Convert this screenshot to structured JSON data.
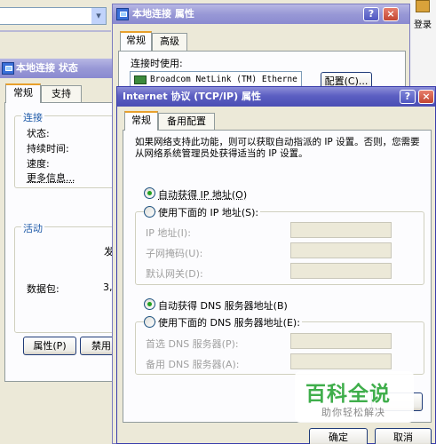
{
  "desktop": {
    "right_label": "登录"
  },
  "back_window": {
    "dropdown_arrow": "▾"
  },
  "status_window": {
    "title": "本地连接 状态",
    "tabs": [
      "常规",
      "支持"
    ],
    "connection_group": "连接",
    "rows": [
      "状态:",
      "持续时间:",
      "速度:"
    ],
    "more_info": "更多信息...",
    "activity_group": "活动",
    "sent_partial": "发",
    "packets_label": "数据包:",
    "packets_partial": "3,",
    "properties_button": "属性(P)",
    "disable_button": "禁用"
  },
  "props_window": {
    "title": "本地连接 属性",
    "tabs": [
      "常规",
      "高级"
    ],
    "connect_using_label": "连接时使用:",
    "adapter_name": "Broadcom NetLink (TM) Etherne",
    "configure_button": "配置(C)...",
    "help_button": "?",
    "close_button": "×"
  },
  "tcpip_window": {
    "title": "Internet 协议 (TCP/IP) 属性",
    "help_button": "?",
    "close_button": "×",
    "tabs": [
      "常规",
      "备用配置"
    ],
    "description": "如果网络支持此功能，则可以获取自动指派的 IP 设置。否则，您需要从网络系统管理员处获得适当的 IP 设置。",
    "auto_ip_label": "自动获得 IP 地址(O)",
    "manual_ip_label": "使用下面的 IP 地址(S):",
    "ip_address_label": "IP 地址(I):",
    "subnet_mask_label": "子网掩码(U):",
    "gateway_label": "默认网关(D):",
    "auto_dns_label": "自动获得 DNS 服务器地址(B)",
    "manual_dns_label": "使用下面的 DNS 服务器地址(E):",
    "preferred_dns_label": "首选 DNS 服务器(P):",
    "alternate_dns_label": "备用 DNS 服务器(A):",
    "ok_button": "确定",
    "cancel_button": "取消",
    "selected_ip_mode": "auto",
    "selected_dns_mode": "auto"
  },
  "watermark": {
    "title": "百科全说",
    "subtitle": "助你轻松解决"
  },
  "colors": {
    "titlebar_active": "#5c5fc2",
    "titlebar_inactive": "#9898d6",
    "window_face": "#ece9d8",
    "tab_accent": "#e8a02c",
    "link": "#0033cc",
    "watermark_green": "#3fae4b"
  }
}
